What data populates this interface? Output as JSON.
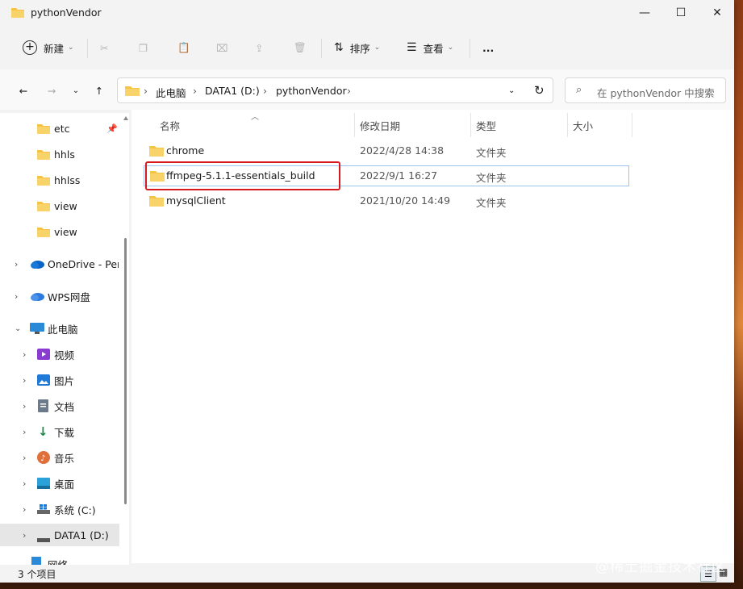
{
  "window": {
    "title": "pythonVendor"
  },
  "toolbar": {
    "new_label": "新建",
    "sort_label": "排序",
    "view_label": "查看",
    "more_label": "..."
  },
  "address": {
    "crumbs": [
      "此电脑",
      "DATA1 (D:)",
      "pythonVendor"
    ]
  },
  "search": {
    "placeholder": "在 pythonVendor 中搜索"
  },
  "sidebar": {
    "items": [
      {
        "label": "etc"
      },
      {
        "label": "hhls"
      },
      {
        "label": "hhlss"
      },
      {
        "label": "view"
      },
      {
        "label": "view"
      },
      {
        "label": "OneDrive - Pers"
      },
      {
        "label": "WPS网盘"
      },
      {
        "label": "此电脑"
      },
      {
        "label": "视频"
      },
      {
        "label": "图片"
      },
      {
        "label": "文档"
      },
      {
        "label": "下载"
      },
      {
        "label": "音乐"
      },
      {
        "label": "桌面"
      },
      {
        "label": "系统 (C:)"
      },
      {
        "label": "DATA1 (D:)"
      },
      {
        "label": "网络"
      }
    ]
  },
  "columns": {
    "name": "名称",
    "date": "修改日期",
    "type": "类型",
    "size": "大小"
  },
  "files": [
    {
      "name": "chrome",
      "date": "2022/4/28 14:38",
      "type": "文件夹"
    },
    {
      "name": "ffmpeg-5.1.1-essentials_build",
      "date": "2022/9/1 16:27",
      "type": "文件夹"
    },
    {
      "name": "mysqlClient",
      "date": "2021/10/20 14:49",
      "type": "文件夹"
    }
  ],
  "status": {
    "count": "3 个项目"
  },
  "watermark": {
    "text": "@稀土掘金技术社区"
  },
  "colors": {
    "folder": "#f5c542",
    "highlight": "#d71920",
    "selected_border": "#9dc4ea"
  }
}
